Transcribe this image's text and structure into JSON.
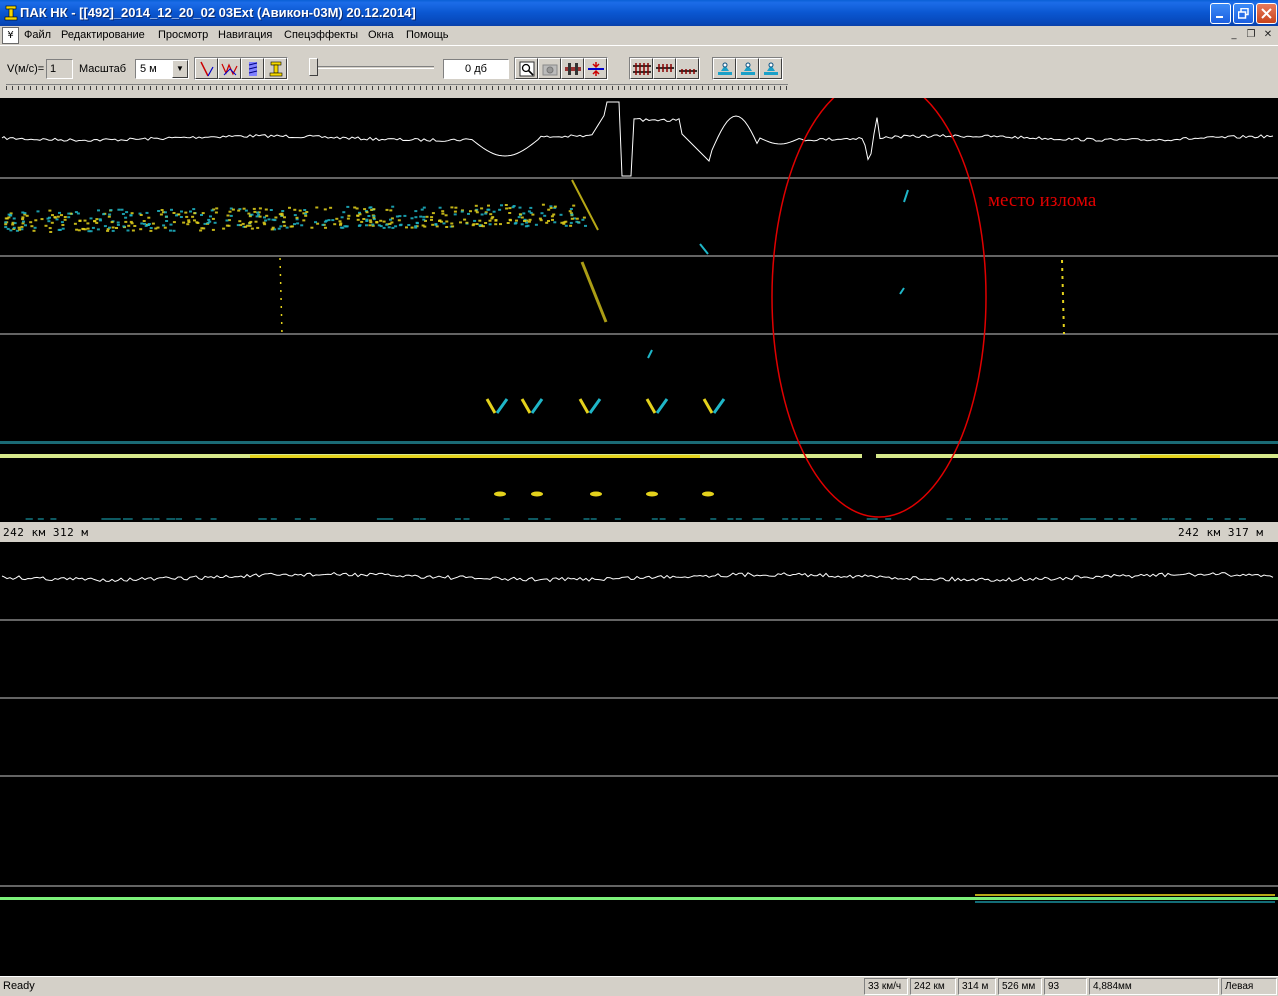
{
  "window": {
    "title": "ПАК НК - [[492]_2014_12_20_02 03Ext (Авикон-03М) 20.12.2014]",
    "controls": [
      "minimize-icon",
      "restore-icon",
      "close-icon"
    ]
  },
  "menu": {
    "items": [
      "Файл",
      "Редактирование",
      "Просмотр",
      "Навигация",
      "Спецэффекты",
      "Окна",
      "Помощь"
    ],
    "mdi_controls": [
      "_",
      "❐",
      "✕"
    ]
  },
  "toolbar": {
    "velocity_label": "V(м/с)=",
    "velocity_value": "1",
    "scale_label": "Масштаб",
    "scale_value": "5 м",
    "gain_value": "0 дб",
    "buttons": [
      "rail-view-icon",
      "wave-view-icon",
      "hatch-view-icon",
      "rail-profile-icon",
      "zoom-search-icon",
      "camera-icon",
      "sleeper-icon",
      "split-arrows-icon",
      "track-grid-icon",
      "track-half-icon",
      "track-short-icon",
      "probe-left-icon",
      "probe-center-icon",
      "probe-right-icon"
    ]
  },
  "annotation": {
    "text": "место излома",
    "color": "#e00000"
  },
  "separator": {
    "left_coord": "242 км 312 м",
    "right_coord": "242 км 317 м"
  },
  "colors": {
    "signal_yellow": "#e4d21c",
    "signal_cyan": "#1fb6c8",
    "signal_green": "#7cf07a",
    "trace_white": "#ffffff",
    "background": "#000000"
  },
  "status": {
    "ready": "Ready",
    "speed": "33 км/ч",
    "km": "242 км",
    "m": "314 м",
    "mm": "526 мм",
    "count": "93",
    "depth": "4,884мм",
    "empty": "",
    "side": "Левая"
  }
}
